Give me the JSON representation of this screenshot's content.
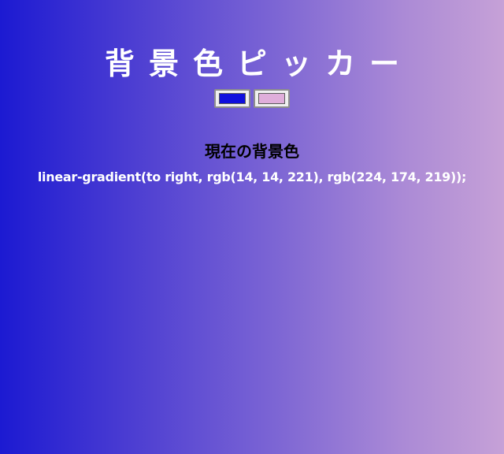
{
  "title": "背景色ピッカー",
  "pickers": [
    {
      "label": "color-picker-left",
      "value": "#0e0edd"
    },
    {
      "label": "color-picker-right",
      "value": "#e0aedb"
    }
  ],
  "current": {
    "heading": "現在の背景色",
    "css": "linear-gradient(to right, rgb(14, 14, 221), rgb(224, 174, 219));"
  },
  "colors": {
    "gradient_start": "#1c1ad2",
    "gradient_end": "#c6a1d7",
    "title_color": "#ffffff",
    "heading_color": "#000000"
  }
}
